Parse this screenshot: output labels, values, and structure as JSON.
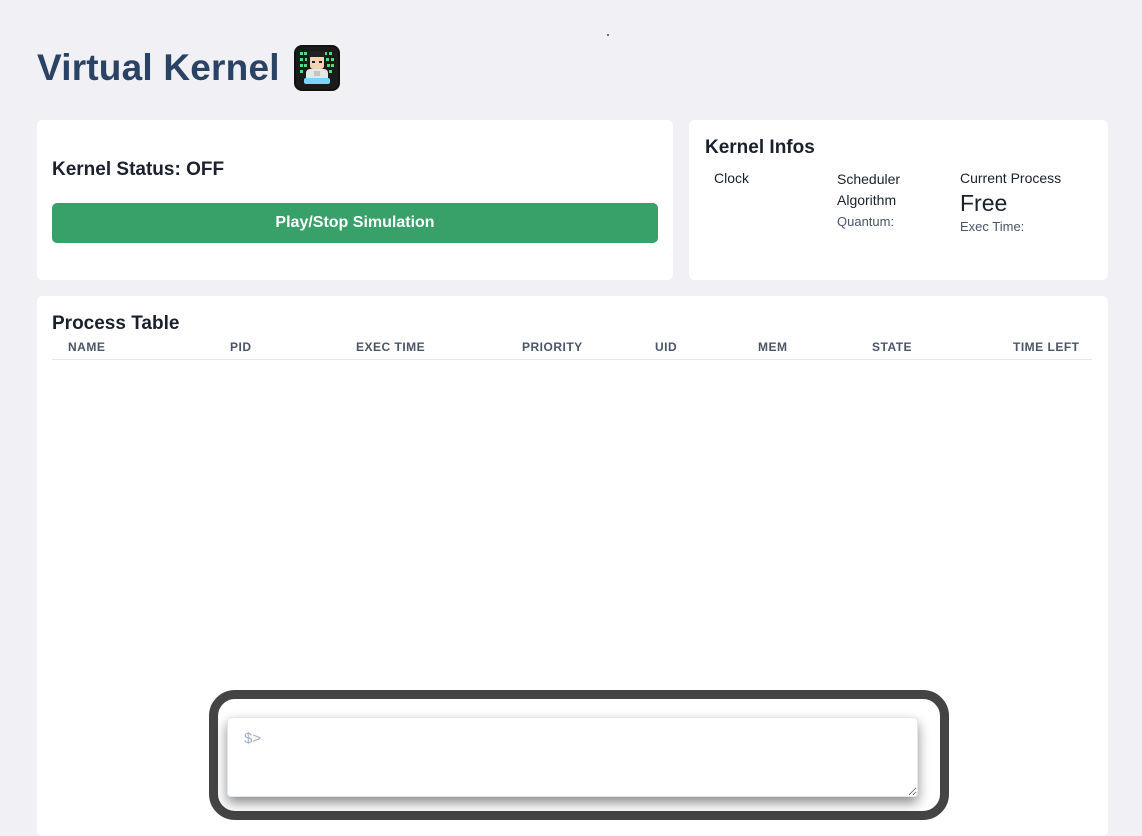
{
  "header": {
    "title": "Virtual Kernel"
  },
  "status_card": {
    "status_text": "Kernel Status: OFF",
    "play_button_label": "Play/Stop Simulation"
  },
  "infos_card": {
    "title": "Kernel Infos",
    "clock_label": "Clock",
    "scheduler_label": "Scheduler",
    "algorithm_label": "Algorithm",
    "quantum_label": "Quantum:",
    "current_process_label": "Current Process",
    "current_process_value": "Free",
    "exec_time_label": "Exec Time:"
  },
  "process_table": {
    "title": "Process Table",
    "columns": [
      "NAME",
      "PID",
      "EXEC TIME",
      "PRIORITY",
      "UID",
      "MEM",
      "STATE",
      "TIME LEFT"
    ],
    "rows": []
  },
  "terminal": {
    "placeholder": "$>",
    "value": ""
  },
  "colors": {
    "background": "#f0f0f5",
    "title": "#2a4365",
    "play_button": "#38a169",
    "terminal_frame": "#444444"
  }
}
